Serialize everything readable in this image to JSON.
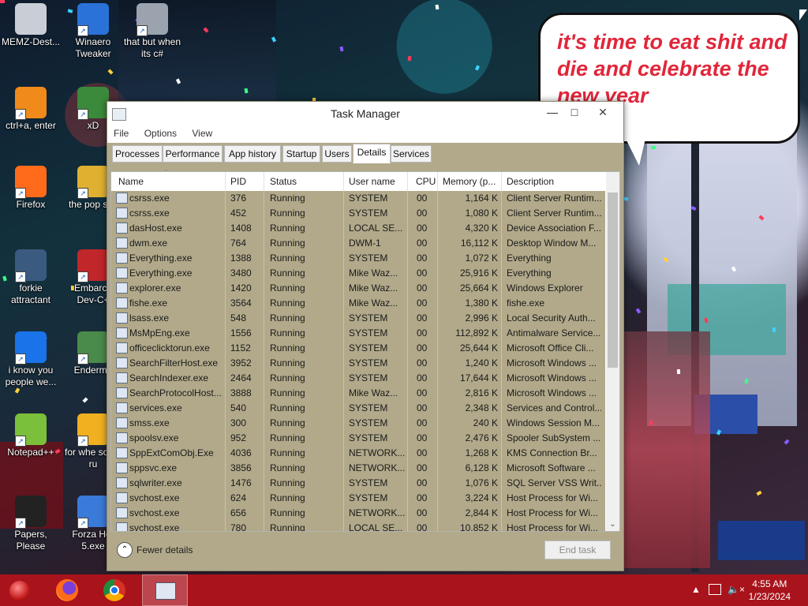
{
  "bubble": {
    "text": "it's time to eat shit and die and celebrate the new year"
  },
  "desktop_icons": [
    {
      "label": "MEMZ-Dest...",
      "icon": "recycle-bin-icon"
    },
    {
      "label": "Winaero Tweaker",
      "icon": "winaero-icon"
    },
    {
      "label": "that but when its c#",
      "icon": "stacked-windows-icon"
    },
    {
      "label": "ctrl+a, enter",
      "icon": "orange-ring-icon"
    },
    {
      "label": "xD",
      "icon": "hxd-icon"
    },
    {
      "label": "Firefox",
      "icon": "firefox-icon"
    },
    {
      "label": "the pop shit",
      "icon": "folder-icon"
    },
    {
      "label": "forkie attractant",
      "icon": "gear-monitor-icon"
    },
    {
      "label": "Embarca Dev-C+",
      "icon": "devcpp-icon"
    },
    {
      "label": "i know you people we...",
      "icon": "chrome-icon"
    },
    {
      "label": "Enderma",
      "icon": "window-icon"
    },
    {
      "label": "Notepad++",
      "icon": "notepadpp-icon"
    },
    {
      "label": "for whe some ru",
      "icon": "dev-icon"
    },
    {
      "label": "Papers, Please",
      "icon": "papers-please-icon"
    },
    {
      "label": "Forza Hor 5.exe",
      "icon": "flash-icon"
    }
  ],
  "task_manager": {
    "title": "Task Manager",
    "menu": [
      "File",
      "Options",
      "View"
    ],
    "tabs": [
      "Processes",
      "Performance",
      "App history",
      "Startup",
      "Users",
      "Details",
      "Services"
    ],
    "active_tab": "Details",
    "columns": [
      "Name",
      "PID",
      "Status",
      "User name",
      "CPU",
      "Memory (p...",
      "Description"
    ],
    "rows": [
      [
        "csrss.exe",
        "376",
        "Running",
        "SYSTEM",
        "00",
        "1,164 K",
        "Client Server Runtim..."
      ],
      [
        "csrss.exe",
        "452",
        "Running",
        "SYSTEM",
        "00",
        "1,080 K",
        "Client Server Runtim..."
      ],
      [
        "dasHost.exe",
        "1408",
        "Running",
        "LOCAL SE...",
        "00",
        "4,320 K",
        "Device Association F..."
      ],
      [
        "dwm.exe",
        "764",
        "Running",
        "DWM-1",
        "00",
        "16,112 K",
        "Desktop Window M..."
      ],
      [
        "Everything.exe",
        "1388",
        "Running",
        "SYSTEM",
        "00",
        "1,072 K",
        "Everything"
      ],
      [
        "Everything.exe",
        "3480",
        "Running",
        "Mike Waz...",
        "00",
        "25,916 K",
        "Everything"
      ],
      [
        "explorer.exe",
        "1420",
        "Running",
        "Mike Waz...",
        "00",
        "25,664 K",
        "Windows Explorer"
      ],
      [
        "fishe.exe",
        "3564",
        "Running",
        "Mike Waz...",
        "00",
        "1,380 K",
        "fishe.exe"
      ],
      [
        "lsass.exe",
        "548",
        "Running",
        "SYSTEM",
        "00",
        "2,996 K",
        "Local Security Auth..."
      ],
      [
        "MsMpEng.exe",
        "1556",
        "Running",
        "SYSTEM",
        "00",
        "112,892 K",
        "Antimalware Service..."
      ],
      [
        "officeclicktorun.exe",
        "1152",
        "Running",
        "SYSTEM",
        "00",
        "25,644 K",
        "Microsoft Office Cli..."
      ],
      [
        "SearchFilterHost.exe",
        "3952",
        "Running",
        "SYSTEM",
        "00",
        "1,240 K",
        "Microsoft Windows ..."
      ],
      [
        "SearchIndexer.exe",
        "2464",
        "Running",
        "SYSTEM",
        "00",
        "17,644 K",
        "Microsoft Windows ..."
      ],
      [
        "SearchProtocolHost....",
        "3888",
        "Running",
        "Mike Waz...",
        "00",
        "2,816 K",
        "Microsoft Windows ..."
      ],
      [
        "services.exe",
        "540",
        "Running",
        "SYSTEM",
        "00",
        "2,348 K",
        "Services and Control..."
      ],
      [
        "smss.exe",
        "300",
        "Running",
        "SYSTEM",
        "00",
        "240 K",
        "Windows Session M..."
      ],
      [
        "spoolsv.exe",
        "952",
        "Running",
        "SYSTEM",
        "00",
        "2,476 K",
        "Spooler SubSystem ..."
      ],
      [
        "SppExtComObj.Exe",
        "4036",
        "Running",
        "NETWORK...",
        "00",
        "1,268 K",
        "KMS Connection Br..."
      ],
      [
        "sppsvc.exe",
        "3856",
        "Running",
        "NETWORK...",
        "00",
        "6,128 K",
        "Microsoft Software ..."
      ],
      [
        "sqlwriter.exe",
        "1476",
        "Running",
        "SYSTEM",
        "00",
        "1,076 K",
        "SQL Server VSS Writ..."
      ],
      [
        "svchost.exe",
        "624",
        "Running",
        "SYSTEM",
        "00",
        "3,224 K",
        "Host Process for Wi..."
      ],
      [
        "svchost.exe",
        "656",
        "Running",
        "NETWORK...",
        "00",
        "2,844 K",
        "Host Process for Wi..."
      ],
      [
        "svchost.exe",
        "780",
        "Running",
        "LOCAL SE...",
        "00",
        "10,852 K",
        "Host Process for Wi..."
      ]
    ],
    "fewer_details": "Fewer details",
    "end_task": "End task"
  },
  "taskbar": {
    "time": "4:55 AM",
    "date": "1/23/2024",
    "accent": "#a9131b",
    "pinned": [
      "start-orb-icon",
      "firefox-icon",
      "chrome-icon",
      "task-manager-icon"
    ]
  }
}
